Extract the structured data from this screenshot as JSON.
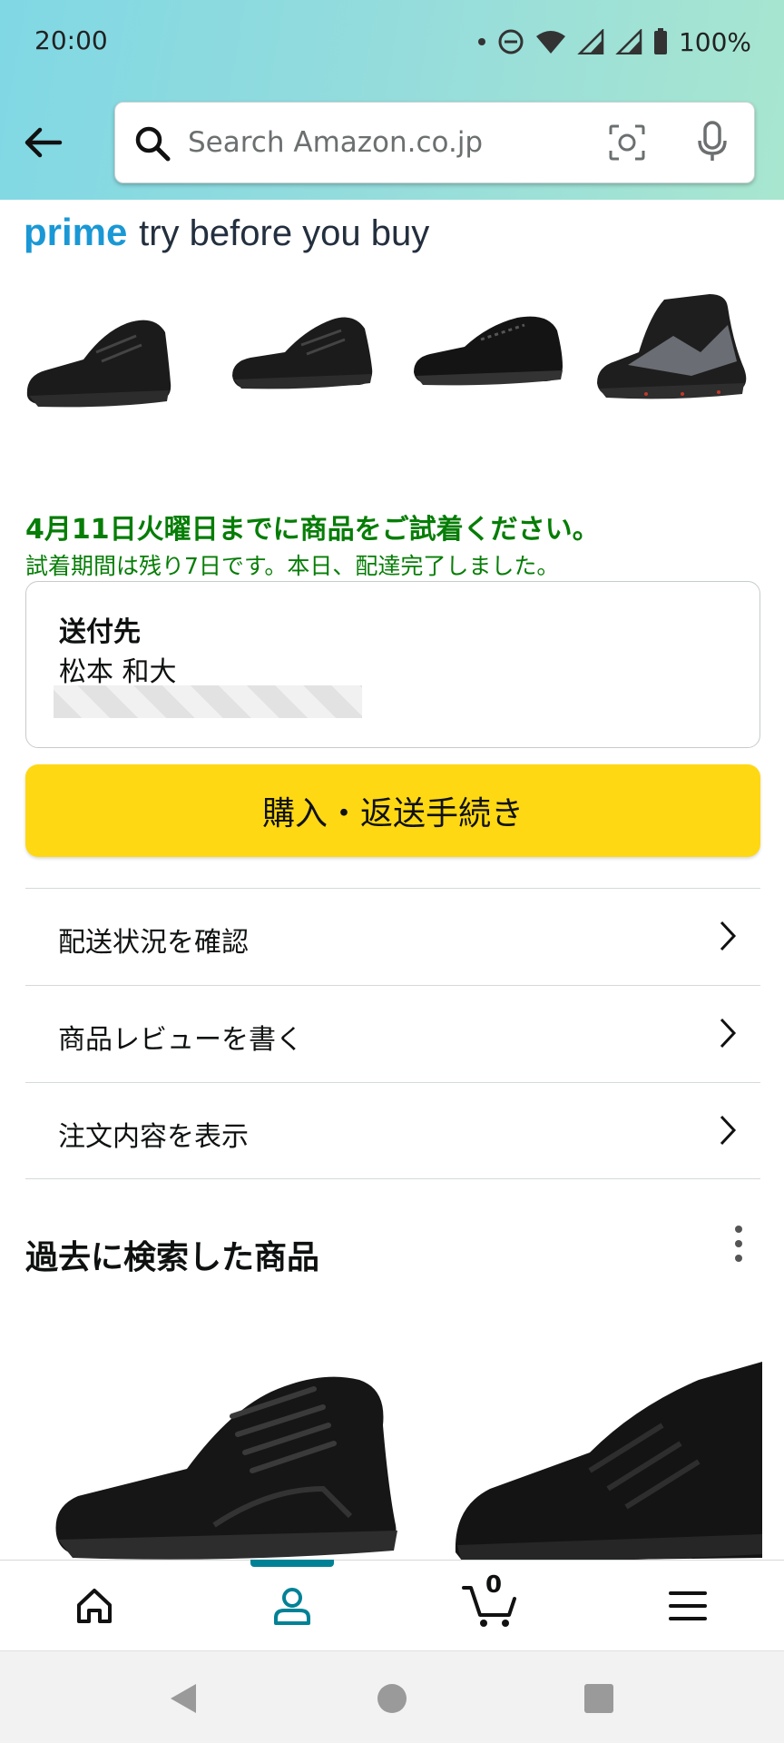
{
  "status_bar": {
    "time": "20:00",
    "battery": "100%"
  },
  "search": {
    "placeholder": "Search Amazon.co.jp"
  },
  "prime_banner": {
    "brand": "prime",
    "tagline": "try before you buy"
  },
  "trial": {
    "deadline": "4月11日火曜日までに商品をご試着ください。",
    "remaining": "試着期間は残り7日です。本日、配達完了しました。"
  },
  "address": {
    "label": "送付先",
    "name": "松本 和大"
  },
  "cta": {
    "label": "購入・返送手続き"
  },
  "menu": {
    "items": [
      {
        "label": "配送状況を確認"
      },
      {
        "label": "商品レビューを書く"
      },
      {
        "label": "注文内容を表示"
      }
    ]
  },
  "recent": {
    "title": "過去に検索した商品"
  },
  "tabbar": {
    "cart_count": "0",
    "active_tab": "account"
  },
  "colors": {
    "prime_blue": "#1a98d5",
    "cta_yellow": "#ffd814",
    "trial_green": "#067d06",
    "accent_teal": "#008296"
  }
}
